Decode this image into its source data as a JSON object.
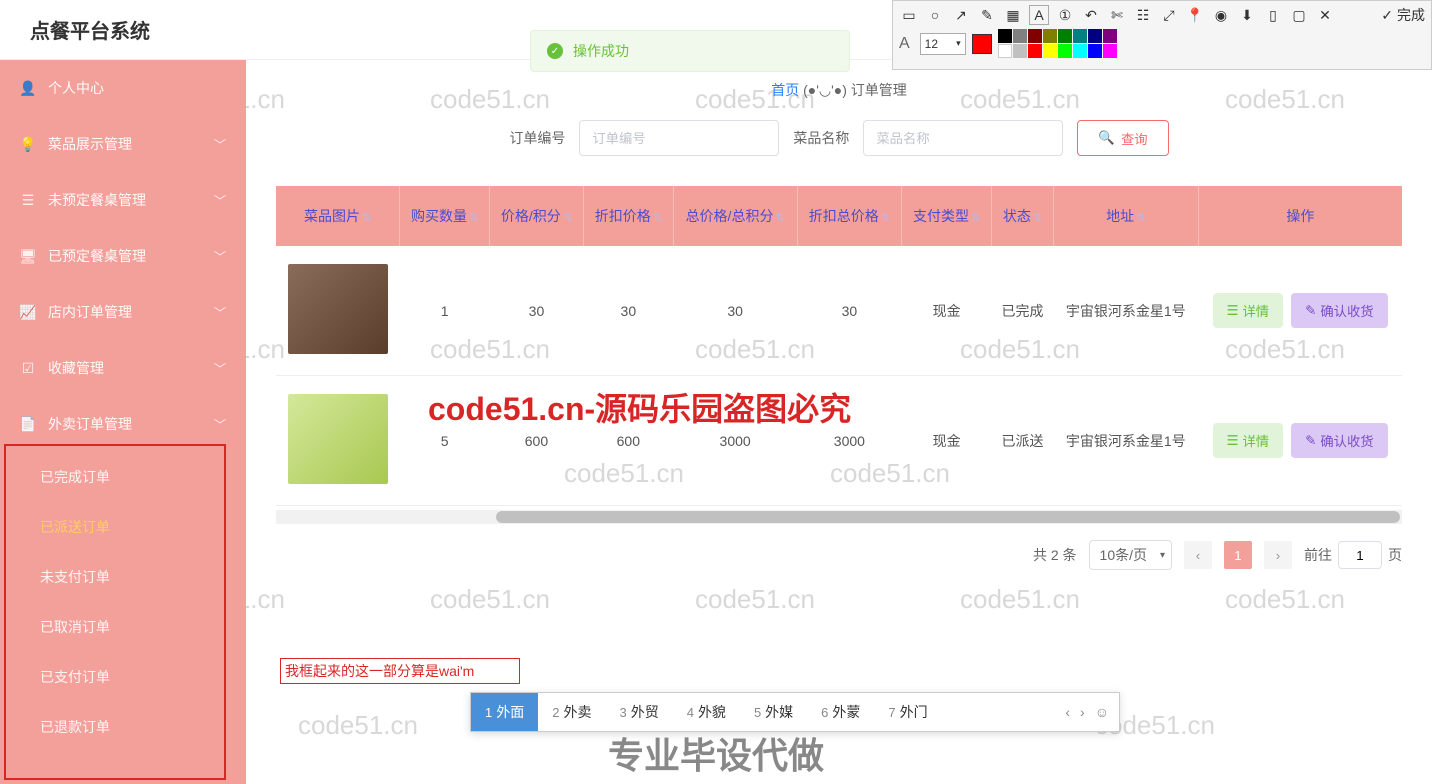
{
  "app_title": "点餐平台系统",
  "toast": {
    "text": "操作成功"
  },
  "anno_toolbar": {
    "font_size": "12",
    "complete_label": "完成",
    "selected_color": "#ff0000",
    "palette": [
      "#000000",
      "#808080",
      "#800000",
      "#808000",
      "#008000",
      "#008080",
      "#000080",
      "#800080",
      "#ffffff",
      "#c0c0c0",
      "#ff0000",
      "#ffff00",
      "#00ff00",
      "#00ffff",
      "#0000ff",
      "#ff00ff"
    ]
  },
  "sidebar": {
    "items": [
      {
        "icon": "user",
        "label": "个人中心",
        "arrow": false
      },
      {
        "icon": "bulb",
        "label": "菜品展示管理",
        "arrow": true
      },
      {
        "icon": "menu",
        "label": "未预定餐桌管理",
        "arrow": true
      },
      {
        "icon": "monitor",
        "label": "已预定餐桌管理",
        "arrow": true
      },
      {
        "icon": "chart",
        "label": "店内订单管理",
        "arrow": true
      },
      {
        "icon": "check",
        "label": "收藏管理",
        "arrow": true
      },
      {
        "icon": "doc",
        "label": "外卖订单管理",
        "arrow": true
      }
    ],
    "submenu": [
      {
        "label": "已完成订单",
        "active": false
      },
      {
        "label": "已派送订单",
        "active": true
      },
      {
        "label": "未支付订单",
        "active": false
      },
      {
        "label": "已取消订单",
        "active": false
      },
      {
        "label": "已支付订单",
        "active": false
      },
      {
        "label": "已退款订单",
        "active": false
      }
    ]
  },
  "breadcrumb": {
    "home": "首页",
    "emoji": "(●'◡'●)",
    "current": "订单管理"
  },
  "search": {
    "order_label": "订单编号",
    "order_placeholder": "订单编号",
    "dish_label": "菜品名称",
    "dish_placeholder": "菜品名称",
    "button": "查询"
  },
  "table": {
    "headers": [
      "菜品图片",
      "购买数量",
      "价格/积分",
      "折扣价格",
      "总价格/总积分",
      "折扣总价格",
      "支付类型",
      "状态",
      "地址",
      "操作"
    ],
    "rows": [
      {
        "qty": "1",
        "price": "30",
        "disc_price": "30",
        "total": "30",
        "disc_total": "30",
        "pay": "现金",
        "status": "已完成",
        "addr": "宇宙银河系金星1号"
      },
      {
        "qty": "5",
        "price": "600",
        "disc_price": "600",
        "total": "3000",
        "disc_total": "3000",
        "pay": "现金",
        "status": "已派送",
        "addr": "宇宙银河系金星1号"
      }
    ],
    "detail_btn": "详情",
    "confirm_btn": "确认收货"
  },
  "pagination": {
    "total_label": "共 2 条",
    "page_size": "10条/页",
    "current": "1",
    "goto_prefix": "前往",
    "goto_value": "1",
    "goto_suffix": "页"
  },
  "annotation_text": "我框起来的这一部分算是wai'm",
  "ime": {
    "candidates": [
      {
        "num": "1",
        "text": "外面"
      },
      {
        "num": "2",
        "text": "外卖"
      },
      {
        "num": "3",
        "text": "外贸"
      },
      {
        "num": "4",
        "text": "外貌"
      },
      {
        "num": "5",
        "text": "外媒"
      },
      {
        "num": "6",
        "text": "外蒙"
      },
      {
        "num": "7",
        "text": "外门"
      }
    ]
  },
  "watermarks": {
    "gray": "code51.cn",
    "red": "code51.cn-源码乐园盗图必究",
    "bottom": "专业毕设代做"
  }
}
